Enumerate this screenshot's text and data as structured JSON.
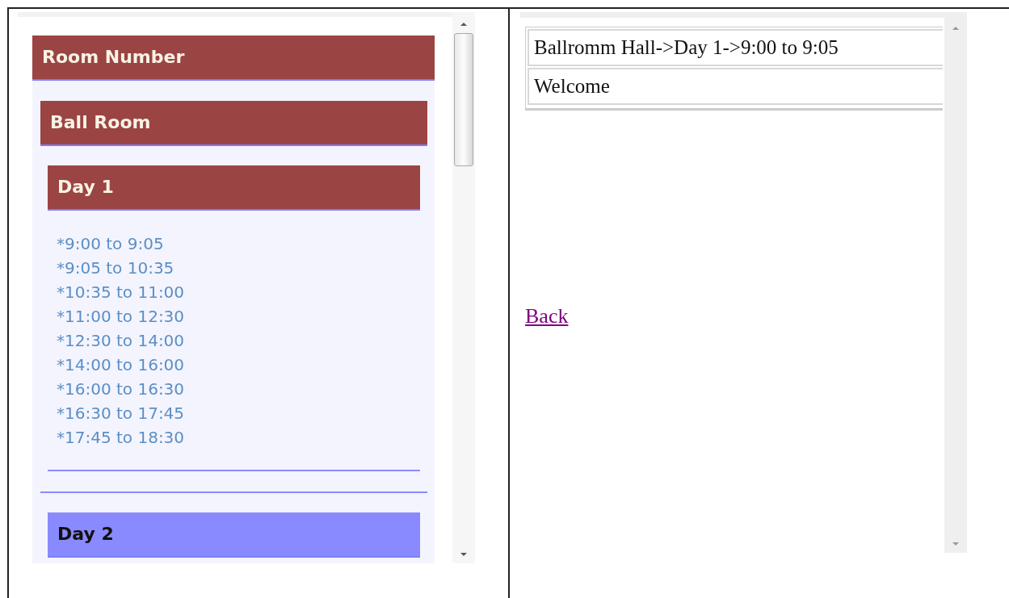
{
  "tree": {
    "title": "Room Number",
    "rooms": [
      {
        "name": "Ball Room",
        "expanded": true,
        "days": [
          {
            "label": "Day 1",
            "expanded": true,
            "sessions": [
              "*9:00 to 9:05",
              "*9:05 to 10:35",
              "*10:35 to 11:00",
              "*11:00 to 12:30",
              "*12:30 to 14:00",
              "*14:00 to 16:00",
              "*16:00 to 16:30",
              "*16:30 to 17:45",
              "*17:45 to 18:30"
            ]
          },
          {
            "label": "Day 2",
            "expanded": false
          }
        ]
      }
    ]
  },
  "details": {
    "rows": [
      "Ballromm Hall->Day 1->9:00 to 9:05",
      "Welcome"
    ],
    "back_link": "Back"
  }
}
